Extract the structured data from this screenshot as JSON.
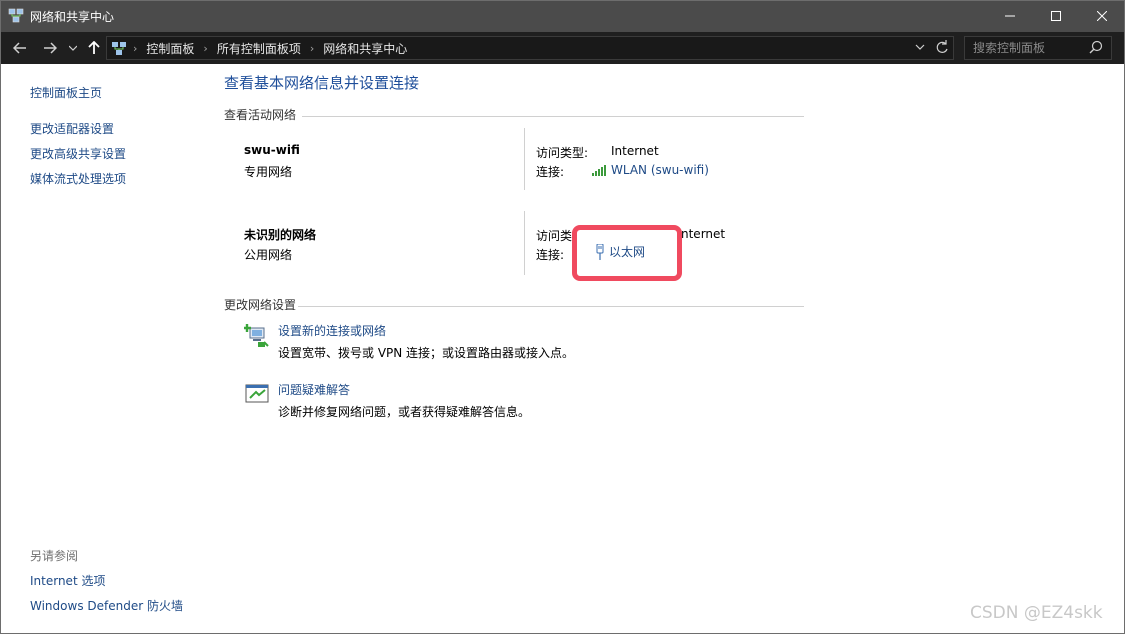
{
  "window": {
    "title": "网络和共享中心",
    "icon": "network-sharing-icon",
    "controls": [
      "minimize-icon",
      "maximize-icon",
      "close-icon"
    ]
  },
  "navbar": {
    "buttons": [
      "back-arrow-icon",
      "forward-arrow-icon",
      "recent-dropdown-icon",
      "up-arrow-icon"
    ],
    "breadcrumb": [
      "控制面板",
      "所有控制面板项",
      "网络和共享中心"
    ],
    "search_placeholder": "搜索控制面板"
  },
  "sidebar": {
    "home": "控制面板主页",
    "links": [
      "更改适配器设置",
      "更改高级共享设置",
      "媒体流式处理选项"
    ],
    "see_also_title": "另请参阅",
    "see_also": [
      "Internet 选项",
      "Windows Defender 防火墙"
    ]
  },
  "main": {
    "title": "查看基本网络信息并设置连接",
    "active_title": "查看活动网络",
    "networks": [
      {
        "name": "swu-wifi",
        "type": "专用网络",
        "access_label": "访问类型:",
        "access_value": "Internet",
        "connection_label": "连接:",
        "connection": "WLAN (swu-wifi)",
        "connection_icon": "wifi-signal-icon"
      },
      {
        "name": "未识别的网络",
        "type": "公用网络",
        "access_label": "访问类",
        "access_value": "nternet",
        "connection_label": "连接:",
        "connection": "以太网",
        "connection_icon": "ethernet-icon"
      }
    ],
    "change_title": "更改网络设置",
    "tasks": [
      {
        "link": "设置新的连接或网络",
        "desc": "设置宽带、拨号或 VPN 连接；或设置路由器或接入点。",
        "icon": "new-connection-icon"
      },
      {
        "link": "问题疑难解答",
        "desc": "诊断并修复网络问题，或者获得疑难解答信息。",
        "icon": "troubleshoot-icon"
      }
    ]
  },
  "colors": {
    "highlight": "#f04a5f",
    "link": "#1e4a86",
    "title": "#1e4e9a"
  },
  "watermark": "CSDN @EZ4skk"
}
